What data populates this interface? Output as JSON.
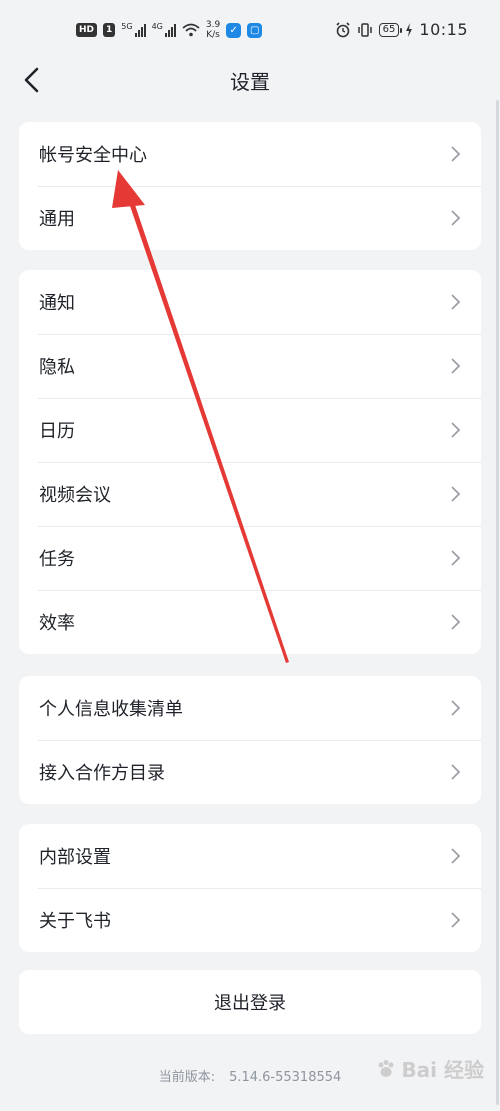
{
  "status_bar": {
    "hd_badge": "HD",
    "sim_badge": "1",
    "net1": "5G",
    "net2": "4G",
    "speed_value": "3.9",
    "speed_unit": "K/s",
    "battery": "65",
    "time": "10:15"
  },
  "header": {
    "title": "设置"
  },
  "groups": [
    {
      "items": [
        "帐号安全中心",
        "通用"
      ]
    },
    {
      "items": [
        "通知",
        "隐私",
        "日历",
        "视频会议",
        "任务",
        "效率"
      ]
    },
    {
      "items": [
        "个人信息收集清单",
        "接入合作方目录"
      ]
    },
    {
      "items": [
        "内部设置",
        "关于飞书"
      ]
    }
  ],
  "logout_label": "退出登录",
  "version": {
    "label": "当前版本:",
    "value": "5.14.6-55318554"
  },
  "watermark": {
    "text": "Bai 经验"
  },
  "colors": {
    "background": "#f2f3f5",
    "card": "#ffffff",
    "annotation_arrow": "#e53935"
  },
  "icons": [
    "back-arrow-icon",
    "chevron-right-icon",
    "wifi-icon",
    "alarm-icon",
    "vibrate-icon",
    "battery-icon",
    "charging-icon"
  ]
}
